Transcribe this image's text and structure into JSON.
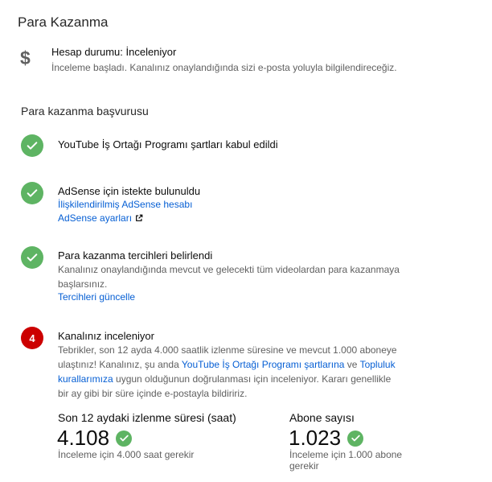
{
  "page": {
    "title": "Para Kazanma"
  },
  "status": {
    "title": "Hesap durumu: İnceleniyor",
    "description": "İnceleme başladı. Kanalınız onaylandığında sizi e-posta yoluyla bilgilendireceğiz."
  },
  "application": {
    "title": "Para kazanma başvurusu",
    "steps": [
      {
        "title": "YouTube İş Ortağı Programı şartları kabul edildi"
      },
      {
        "title": "AdSense için istekte bulunuldu",
        "link1": "İlişkilendirilmiş AdSense hesabı",
        "link2": "AdSense ayarları"
      },
      {
        "title": "Para kazanma tercihleri belirlendi",
        "text": "Kanalınız onaylandığında mevcut ve gelecekti tüm videolardan para kazanmaya başlarsınız.",
        "link": "Tercihleri güncelle"
      },
      {
        "number": "4",
        "title": "Kanalınız inceleniyor",
        "text_part1": "Tebrikler, son 12 ayda 4.000 saatlik izlenme süresine ve mevcut 1.000 aboneye ulaştınız! Kanalınız, şu anda ",
        "link1": "YouTube İş Ortağı Programı şartlarına",
        "text_part2": " ve ",
        "link2": "Topluluk kurallarımıza",
        "text_part3": " uygun olduğunun doğrulanması için inceleniyor. Kararı genellikle bir ay gibi bir süre içinde e-postayla bildiririz."
      }
    ]
  },
  "metrics": {
    "watch_time": {
      "label": "Son 12 aydaki izlenme süresi (saat)",
      "value": "4.108",
      "note": "İnceleme için 4.000 saat gerekir"
    },
    "subscribers": {
      "label": "Abone sayısı",
      "value": "1.023",
      "note": "İnceleme için 1.000 abone gerekir"
    }
  },
  "colors": {
    "check_green": "#5eb463",
    "step_red": "#cc0000",
    "link_blue": "#065fd4"
  }
}
